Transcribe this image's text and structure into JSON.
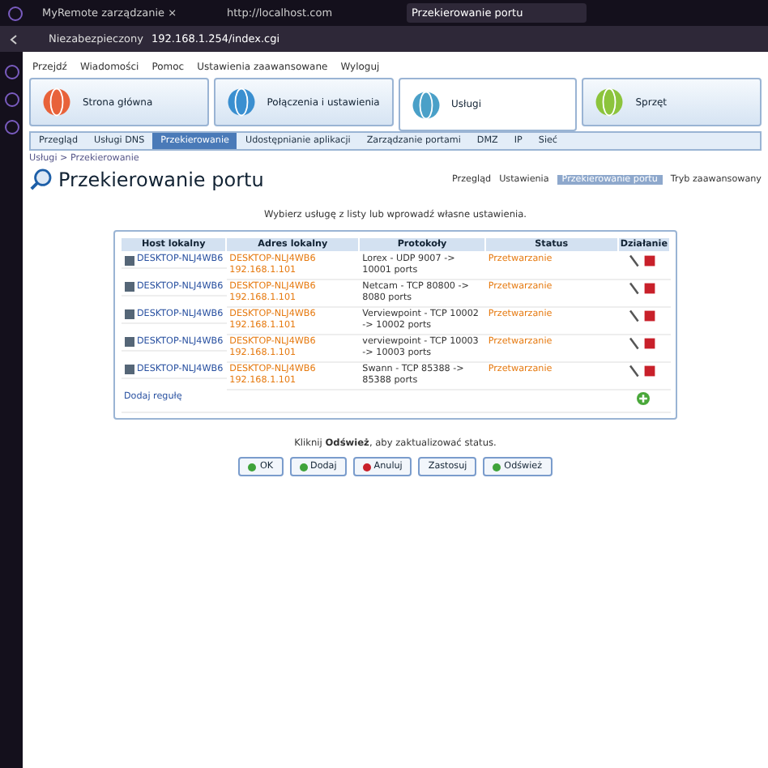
{
  "browser": {
    "tabs": [
      {
        "title": "MyRemote zarządzanie ×",
        "selected": false
      },
      {
        "title": "http://localhost.com",
        "selected": false
      },
      {
        "title": "Przekierowanie portu",
        "selected": true
      }
    ],
    "security": "Niezabezpieczony",
    "url": "192.168.1.254/index.cgi"
  },
  "bookmarks": [
    "Przejdź",
    "Wiadomości",
    "Pomoc",
    "Ustawienia zaawansowane",
    "Wyloguj"
  ],
  "main_nav": [
    {
      "label": "Strona główna",
      "selected": false
    },
    {
      "label": "Połączenia i ustawienia",
      "selected": false
    },
    {
      "label": "Usługi",
      "selected": true
    },
    {
      "label": "Sprzęt",
      "selected": false
    }
  ],
  "sub_nav": [
    {
      "label": "Przegląd",
      "selected": false
    },
    {
      "label": "Usługi DNS",
      "selected": false
    },
    {
      "label": "Przekierowanie",
      "selected": true
    },
    {
      "label": "Udostępnianie aplikacji",
      "selected": false
    },
    {
      "label": "Zarządzanie portami",
      "selected": false
    },
    {
      "label": "DMZ",
      "selected": false
    },
    {
      "label": "IP",
      "selected": false
    },
    {
      "label": "Sieć",
      "selected": false
    }
  ],
  "breadcrumb": "Usługi > Przekierowanie",
  "page_title": "Przekierowanie portu",
  "view_links": [
    {
      "label": "Przegląd",
      "selected": false
    },
    {
      "label": "Ustawienia",
      "selected": false
    },
    {
      "label": "Przekierowanie portu",
      "selected": true
    },
    {
      "label": "Tryb zaawansowany",
      "selected": false
    }
  ],
  "intro": "Wybierz usługę z listy lub wprowadź własne ustawienia.",
  "table": {
    "columns": [
      "Host lokalny",
      "Adres lokalny",
      "Protokoły",
      "Status",
      "Działanie"
    ],
    "rows": [
      {
        "checked": true,
        "host": "DESKTOP-NLJ4WB6",
        "address": "DESKTOP-NLJ4WB6 192.168.1.101",
        "protocols": "Lorex - UDP 9007 -> 10001 ports",
        "status": "Przetwarzanie"
      },
      {
        "checked": true,
        "host": "DESKTOP-NLJ4WB6",
        "address": "DESKTOP-NLJ4WB6 192.168.1.101",
        "protocols": "Netcam - TCP 80800 -> 8080 ports",
        "status": "Przetwarzanie"
      },
      {
        "checked": true,
        "host": "DESKTOP-NLJ4WB6",
        "address": "DESKTOP-NLJ4WB6 192.168.1.101",
        "protocols": "Verviewpoint - TCP 10002 -> 10002 ports",
        "status": "Przetwarzanie"
      },
      {
        "checked": true,
        "host": "DESKTOP-NLJ4WB6",
        "address": "DESKTOP-NLJ4WB6 192.168.1.101",
        "protocols": "verviewpoint - TCP 10003 -> 10003 ports",
        "status": "Przetwarzanie"
      },
      {
        "checked": true,
        "host": "DESKTOP-NLJ4WB6",
        "address": "DESKTOP-NLJ4WB6 192.168.1.101",
        "protocols": "Swann - TCP 85388 -> 85388 ports",
        "status": "Przetwarzanie"
      }
    ],
    "footer_link": "Dodaj regułę"
  },
  "note": "Kliknij **Odśwież**, aby zaktualizować status.",
  "buttons": [
    {
      "label": "OK",
      "kind": "ok"
    },
    {
      "label": "Dodaj",
      "kind": "add"
    },
    {
      "label": "Anuluj",
      "kind": "cancel"
    },
    {
      "label": "Zastosuj",
      "kind": "plain"
    },
    {
      "label": "Odśwież",
      "kind": "ok"
    }
  ]
}
